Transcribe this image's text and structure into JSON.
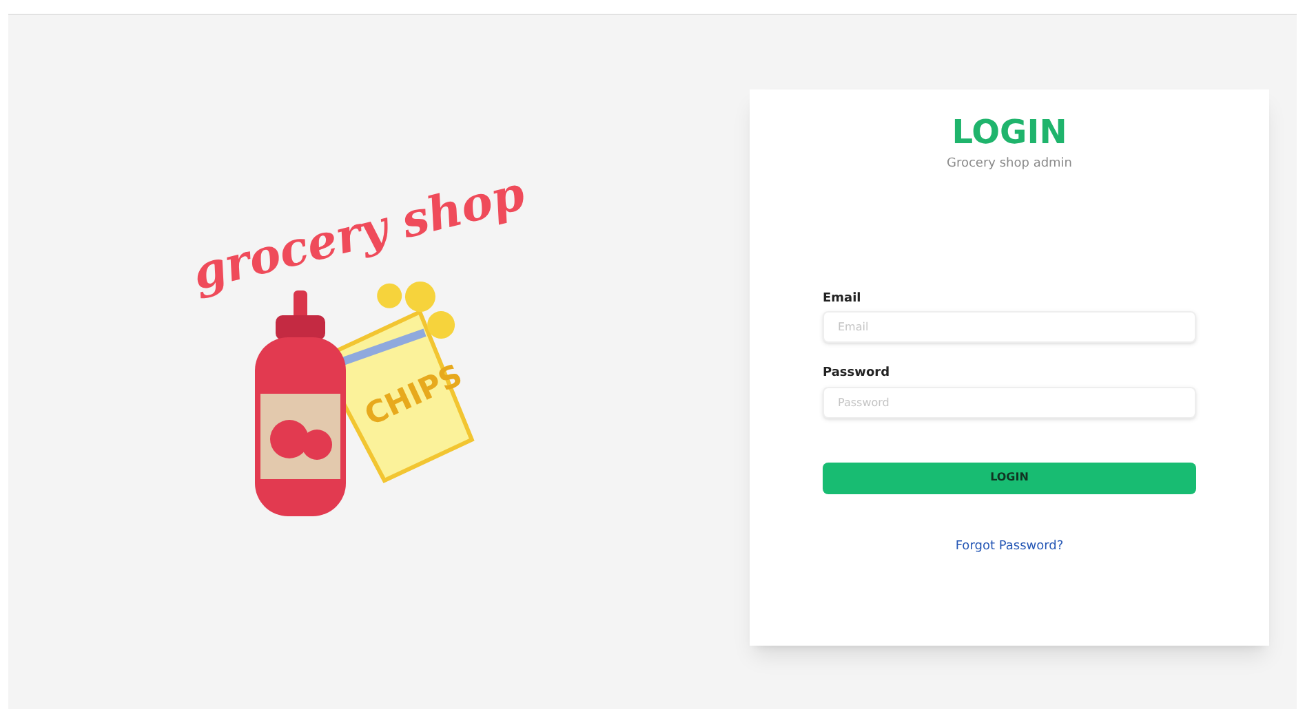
{
  "illustration": {
    "headline": "grocery shop",
    "bag_label": "CHIPS"
  },
  "login_card": {
    "title": "LOGIN",
    "subtitle": "Grocery shop admin",
    "fields": [
      {
        "label": "Email",
        "placeholder": "Email"
      },
      {
        "label": "Password",
        "placeholder": "Password"
      }
    ],
    "submit": "LOGIN",
    "forgot_link": "Forgot Password?"
  }
}
